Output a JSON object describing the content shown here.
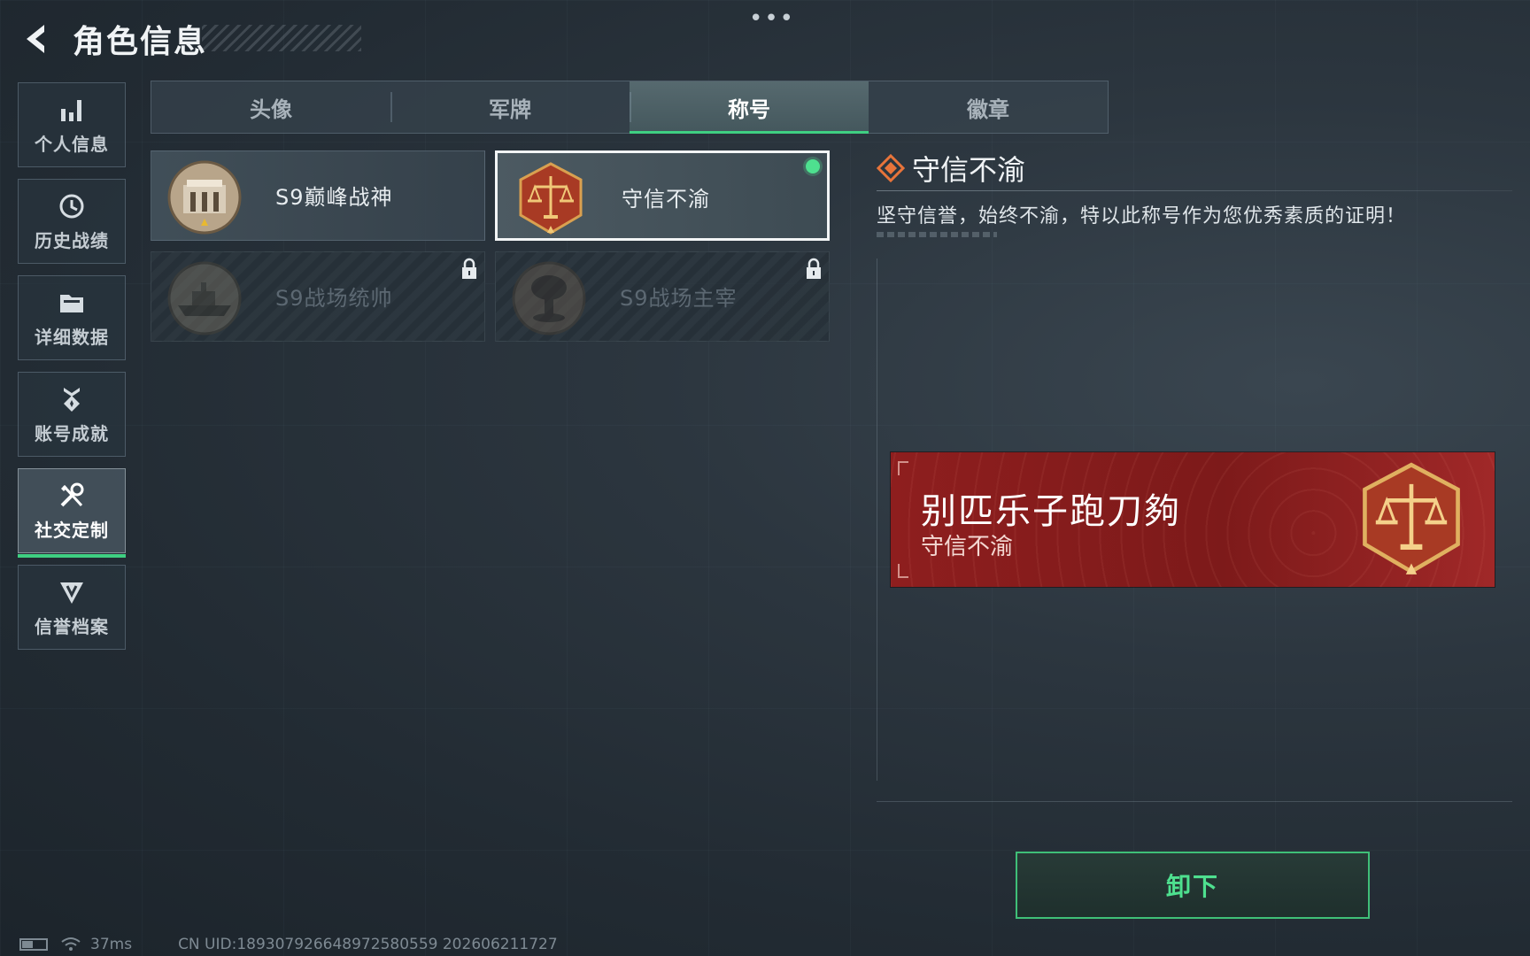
{
  "header": {
    "title": "角色信息",
    "back_icon": "back-arrow-icon",
    "more_icon": "more-dots-icon",
    "more_label": "•••"
  },
  "sidebar": {
    "items": [
      {
        "label": "个人信息",
        "icon": "bar-chart-icon",
        "active": false
      },
      {
        "label": "历史战绩",
        "icon": "history-clock-icon",
        "active": false
      },
      {
        "label": "详细数据",
        "icon": "folder-icon",
        "active": false
      },
      {
        "label": "账号成就",
        "icon": "achievement-medal-icon",
        "active": false
      },
      {
        "label": "社交定制",
        "icon": "tools-icon",
        "active": true
      },
      {
        "label": "信誉档案",
        "icon": "credit-shield-icon",
        "active": false
      }
    ]
  },
  "tabs": [
    {
      "label": "头像",
      "active": false
    },
    {
      "label": "军牌",
      "active": false
    },
    {
      "label": "称号",
      "active": true
    },
    {
      "label": "徽章",
      "active": false
    }
  ],
  "titles": [
    {
      "name": "S9巅峰战神",
      "emblem": "fortress-emblem-icon",
      "state": "owned"
    },
    {
      "name": "守信不渝",
      "emblem": "scales-emblem-icon",
      "state": "selected"
    },
    {
      "name": "S9战场统帅",
      "emblem": "warship-emblem-icon",
      "state": "locked"
    },
    {
      "name": "S9战场主宰",
      "emblem": "mushroom-cloud-emblem-icon",
      "state": "locked"
    }
  ],
  "detail": {
    "icon": "diamond-title-icon",
    "title": "守信不渝",
    "description": "坚守信誉，始终不渝，特以此称号作为您优秀素质的证明！"
  },
  "preview": {
    "player_name": "别匹乐子跑刀夠",
    "title": "守信不渝",
    "emblem": "scales-emblem-icon"
  },
  "actions": {
    "unequip_label": "卸下"
  },
  "status": {
    "latency": "37ms",
    "uid": "CN UID:189307926648972580559 202606211727"
  },
  "colors": {
    "accent_green": "#3fcf82",
    "banner_red": "#8e1e1e",
    "selected_dot": "#4ee08f"
  }
}
